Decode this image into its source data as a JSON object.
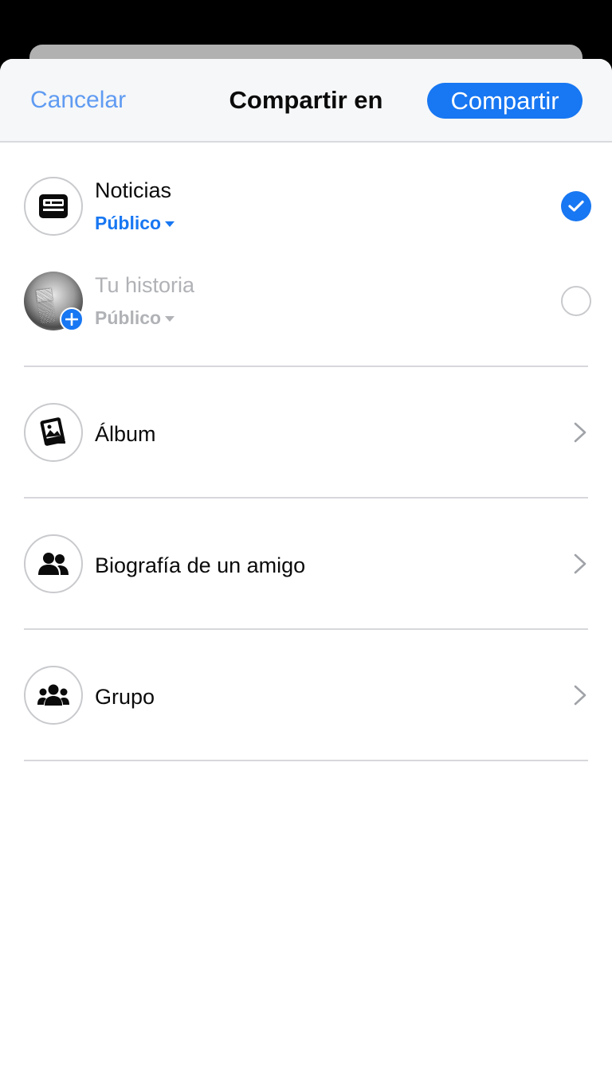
{
  "header": {
    "cancel_label": "Cancelar",
    "title": "Compartir en",
    "share_label": "Compartir"
  },
  "destinations": {
    "news_feed": {
      "label": "Noticias",
      "audience": "Público",
      "icon": "news-feed-icon",
      "selected": true
    },
    "story": {
      "label": "Tu historia",
      "audience": "Público",
      "icon": "story-avatar",
      "selected": false
    }
  },
  "options": [
    {
      "label": "Álbum",
      "icon": "album-icon"
    },
    {
      "label": "Biografía de un amigo",
      "icon": "friends-icon"
    },
    {
      "label": "Grupo",
      "icon": "group-icon"
    }
  ],
  "colors": {
    "accent": "#1877f2",
    "cancel_text": "#5f9bf2",
    "muted_text": "#b0b2b6",
    "header_bg": "#f6f7f8"
  }
}
